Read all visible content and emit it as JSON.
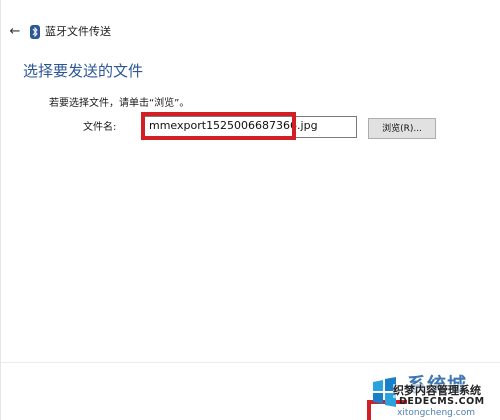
{
  "window": {
    "title": "蓝牙文件传送"
  },
  "icons": {
    "back": "back-arrow-icon",
    "bluetooth": "bluetooth-icon"
  },
  "page": {
    "heading": "选择要发送的文件",
    "hint": "若要选择文件，请单击“浏览”。",
    "file_label": "文件名:",
    "file_value": "mmexport1525006687366.jpg",
    "browse_label": "浏览(R)..."
  },
  "colors": {
    "heading": "#2b5797",
    "highlight": "#d21f26",
    "watermark": "#1d5fa8"
  },
  "watermark": {
    "title": "系统城",
    "site_name": "织梦内容管理系统",
    "url": "DEDECMS.COM",
    "domain": "xitongcheng.com"
  }
}
